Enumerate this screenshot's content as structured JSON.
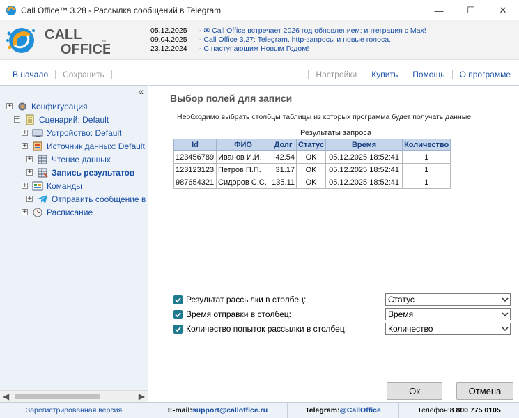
{
  "window": {
    "title": "Call Office™ 3.28 - Рассылка сообщений в Telegram",
    "minimize": "—",
    "maximize": "☐",
    "close": "✕"
  },
  "logo": {
    "line1": "CALL",
    "line2": "OFFICE",
    "tm": "™"
  },
  "news": [
    {
      "date": "05.12.2025",
      "text": "- ✉ Call Office встречает 2026 год обновлением: интеграция с Max!"
    },
    {
      "date": "09.04.2025",
      "text": "- Call Office 3.27: Telegram, http-запросы и новые голоса."
    },
    {
      "date": "23.12.2024",
      "text": "- С наступающим Новым Годом!"
    }
  ],
  "toolbar": {
    "home": "В начало",
    "save": "Сохранить",
    "settings": "Настройки",
    "buy": "Купить",
    "help": "Помощь",
    "about": "О программе"
  },
  "tree": {
    "collapse": "«",
    "items": [
      {
        "label": "Конфигурация",
        "expander": "+",
        "icon": "gear-icon"
      },
      {
        "label": "Сценарий: Default",
        "expander": "+",
        "icon": "scenario-icon"
      },
      {
        "label": "Устройство: Default",
        "expander": "+",
        "icon": "device-icon"
      },
      {
        "label": "Источник данных: Default",
        "expander": "+",
        "icon": "datasource-icon"
      },
      {
        "label": "Чтение данных",
        "expander": "+",
        "icon": "read-data-icon"
      },
      {
        "label": "Запись результатов",
        "expander": "+",
        "icon": "write-results-icon"
      },
      {
        "label": "Команды",
        "expander": "+",
        "icon": "commands-icon"
      },
      {
        "label": "Отправить сообщение в",
        "expander": "+",
        "icon": "telegram-icon"
      },
      {
        "label": "Расписание",
        "expander": "+",
        "icon": "schedule-icon"
      }
    ]
  },
  "main": {
    "title": "Выбор полей для записи",
    "description": "Необходимо выбрать столбцы таблицы из которых программа будет получать данные.",
    "table_caption": "Результаты запроса",
    "columns": [
      "Id",
      "ФИО",
      "Долг",
      "Статус",
      "Время",
      "Количество"
    ],
    "rows": [
      [
        "123456789",
        "Иванов И.И.",
        "42.54",
        "OK",
        "05.12.2025 18:52:41",
        "1"
      ],
      [
        "123123123",
        "Петров П.П.",
        "31.17",
        "OK",
        "05.12.2025 18:52:41",
        "1"
      ],
      [
        "987654321",
        "Сидоров С.С.",
        "135.11",
        "OK",
        "05.12.2025 18:52:41",
        "1"
      ]
    ],
    "options": [
      {
        "label": "Результат рассылки в столбец:",
        "value": "Статус",
        "checked": true
      },
      {
        "label": "Время отправки в столбец:",
        "value": "Время",
        "checked": true
      },
      {
        "label": "Количество попыток рассылки в столбец:",
        "value": "Количество",
        "checked": true
      }
    ]
  },
  "buttons": {
    "ok": "Ок",
    "cancel": "Отмена"
  },
  "statusbar": {
    "registered": "Зарегистрированная версия",
    "email_label": "E-mail: ",
    "email": "support@calloffice.ru",
    "telegram_label": "Telegram: ",
    "telegram": "@CallOffice",
    "phone_label": "Телефон: ",
    "phone": "8 800 775 0105"
  },
  "colors": {
    "accent": "#1a4fa3",
    "checkbox": "#1e7a8c",
    "panel": "#edf2f8",
    "table_header": "#c4d5ec"
  }
}
